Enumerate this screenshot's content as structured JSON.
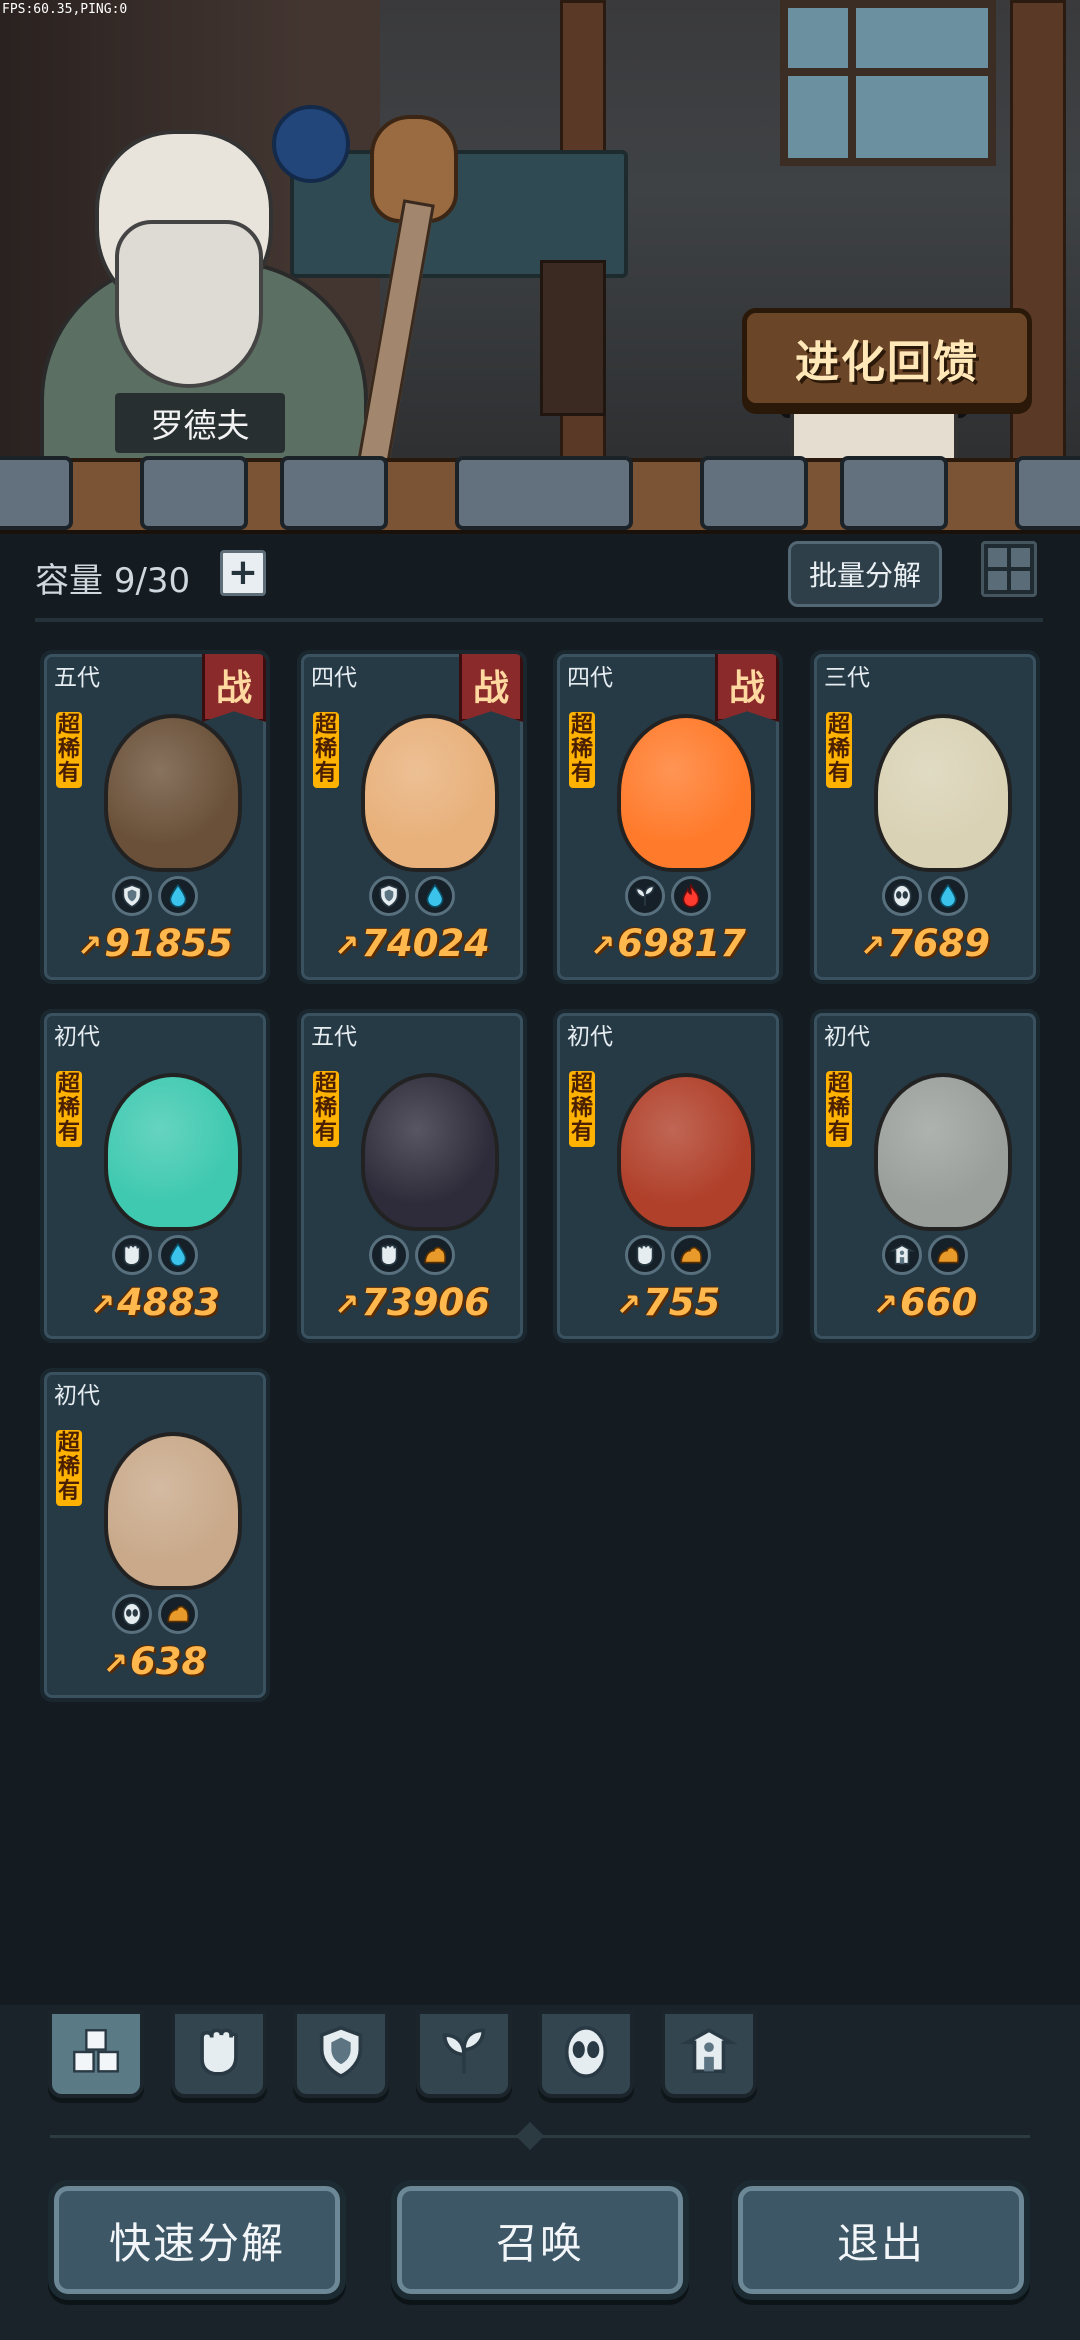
{
  "status_overlay": "FPS:60.35,PING:0",
  "npc": {
    "name": "罗德夫"
  },
  "evolution_sign": "进化回馈",
  "inventory": {
    "capacity_label": "容量",
    "capacity_value": "9/30",
    "add_capacity_symbol": "+",
    "batch_decompose_label": "批量分解"
  },
  "cards": [
    {
      "generation": "五代",
      "battle_tag": "战",
      "rarity": "超稀有",
      "power": "91855",
      "color": "#6a5038",
      "icons": [
        "shield-icon",
        "water-drop-icon"
      ]
    },
    {
      "generation": "四代",
      "battle_tag": "战",
      "rarity": "超稀有",
      "power": "74024",
      "color": "#e8b07a",
      "icons": [
        "shield-icon",
        "water-drop-icon"
      ]
    },
    {
      "generation": "四代",
      "battle_tag": "战",
      "rarity": "超稀有",
      "power": "69817",
      "color": "#ff7a2a",
      "icons": [
        "leaf-icon",
        "fire-icon"
      ]
    },
    {
      "generation": "三代",
      "battle_tag": "",
      "rarity": "超稀有",
      "power": "7689",
      "color": "#d9d2b5",
      "icons": [
        "alien-icon",
        "water-drop-icon"
      ]
    },
    {
      "generation": "初代",
      "battle_tag": "",
      "rarity": "超稀有",
      "power": "4883",
      "color": "#3fc9b0",
      "icons": [
        "fist-icon",
        "water-drop-icon"
      ]
    },
    {
      "generation": "五代",
      "battle_tag": "",
      "rarity": "超稀有",
      "power": "73906",
      "color": "#2e2c3a",
      "icons": [
        "fist-icon",
        "earth-icon"
      ]
    },
    {
      "generation": "初代",
      "battle_tag": "",
      "rarity": "超稀有",
      "power": "755",
      "color": "#b0402a",
      "icons": [
        "fist-icon",
        "earth-icon"
      ]
    },
    {
      "generation": "初代",
      "battle_tag": "",
      "rarity": "超稀有",
      "power": "660",
      "color": "#9a9f9c",
      "icons": [
        "shrine-icon",
        "earth-icon"
      ]
    },
    {
      "generation": "初代",
      "battle_tag": "",
      "rarity": "超稀有",
      "power": "638",
      "color": "#c9a98a",
      "icons": [
        "alien-icon",
        "earth-icon"
      ]
    }
  ],
  "filter_tabs": [
    "all-blocks-icon",
    "fist-icon",
    "shield-icon",
    "leaf-icon",
    "alien-icon",
    "shrine-icon"
  ],
  "buttons": {
    "quick_decompose": "快速分解",
    "summon": "召唤",
    "exit": "退出"
  },
  "colors": {
    "power_text": "#ffb84d",
    "rarity_badge": "#ffb300",
    "battle_badge": "#8b2a2a"
  }
}
